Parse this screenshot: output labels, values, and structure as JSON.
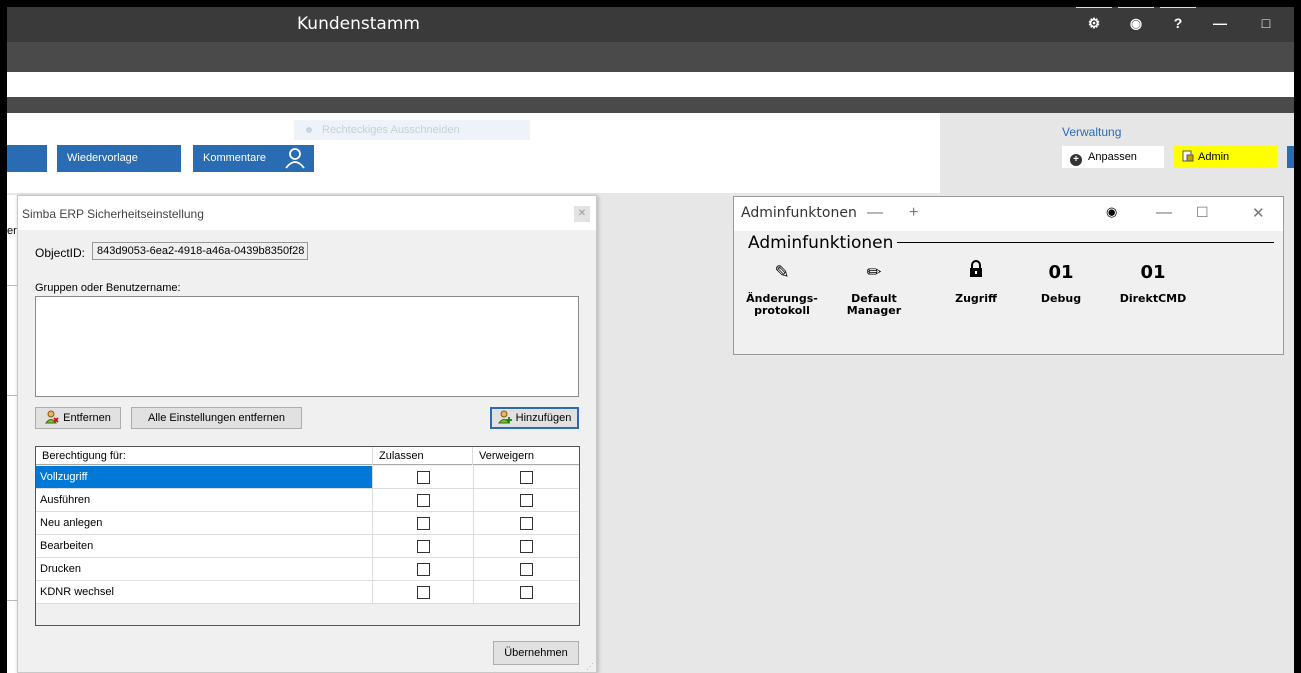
{
  "window": {
    "title": "Kundenstamm",
    "controls": {
      "settings": "⚙",
      "camera": "◉",
      "help": "?",
      "minimize": "—",
      "maximize": "□"
    }
  },
  "ribbon": {
    "wiedervorlage": "Wiedervorlage",
    "kommentare": "Kommentare",
    "ghost_item": "Rechteckiges Ausschneiden"
  },
  "right_panel": {
    "verwaltung": "Verwaltung",
    "anpassen": "Anpassen",
    "admin": "Admin"
  },
  "left_strip": {
    "cut_text": "er"
  },
  "security_dialog": {
    "title": "Simba ERP Sicherheitseinstellung",
    "objectid_label": "ObjectID:",
    "objectid_value": "843d9053-6ea2-4918-a46a-0439b8350f28",
    "groups_label": "Gruppen oder Benutzername:",
    "btn_entfernen": "Entfernen",
    "btn_alle_entfernen": "Alle Einstellungen entfernen",
    "btn_hinzufuegen": "Hinzufügen",
    "table_headers": [
      "Berechtigung für:",
      "Zulassen",
      "Verweigern"
    ],
    "rows": [
      {
        "name": "Vollzugriff",
        "allow": false,
        "deny": false
      },
      {
        "name": "Ausführen",
        "allow": false,
        "deny": false
      },
      {
        "name": "Neu anlegen",
        "allow": false,
        "deny": false
      },
      {
        "name": "Bearbeiten",
        "allow": false,
        "deny": false
      },
      {
        "name": "Drucken",
        "allow": false,
        "deny": false
      },
      {
        "name": "KDNR wechsel",
        "allow": false,
        "deny": false
      }
    ],
    "btn_uebernehmen": "Übernehmen"
  },
  "admin_window": {
    "title": "Adminfunktonen",
    "group_title": "Adminfunktionen",
    "functions": [
      {
        "label_line1": "Änderungs-",
        "label_line2": "protokoll",
        "icon": "log-icon",
        "glyph": "✎"
      },
      {
        "label_line1": "Default",
        "label_line2": "Manager",
        "icon": "pencil-icon",
        "glyph": "✏"
      },
      {
        "label_line1": "Zugriff",
        "label_line2": "",
        "icon": "lock-icon",
        "glyph": "■"
      },
      {
        "label_line1": "Debug",
        "label_line2": "",
        "icon": "binary-icon",
        "glyph": "01"
      },
      {
        "label_line1": "DirektCMD",
        "label_line2": "",
        "icon": "binary-icon",
        "glyph": "01"
      }
    ]
  },
  "colors": {
    "accent_blue": "#2a6cb3",
    "admin_yellow": "#ffff00",
    "selection_blue": "#0078d7"
  }
}
